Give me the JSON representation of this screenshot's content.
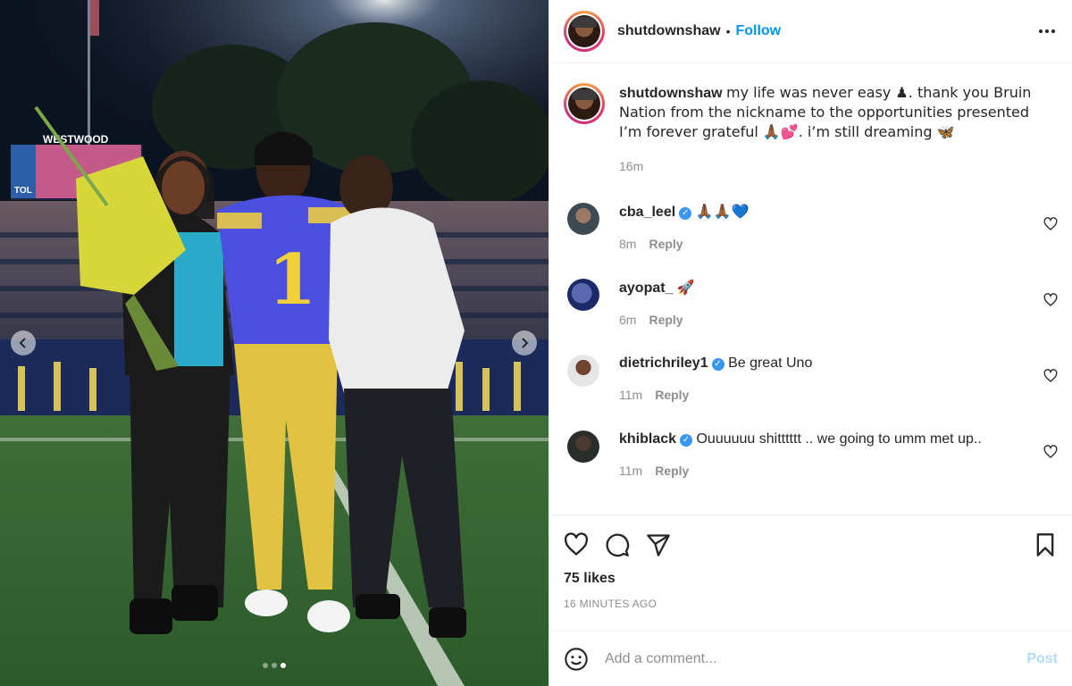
{
  "header": {
    "username": "shutdownshaw",
    "separator": "•",
    "follow_label": "Follow",
    "more_icon": "more-options-icon"
  },
  "media": {
    "prev_icon": "chevron-left-icon",
    "next_icon": "chevron-right-icon",
    "slide_count": 3,
    "active_slide": 3,
    "jersey_number": "1",
    "board_text": "WESTWOOD",
    "scoreboard_text": "TOL"
  },
  "caption": {
    "username": "shutdownshaw",
    "text": "my life was never easy ♟. thank you Bruin Nation from the nickname to the opportunities presented I’m forever grateful 🙏🏾💕. i’m still dreaming 🦋",
    "time": "16m"
  },
  "comments": [
    {
      "username": "cba_leel",
      "verified": true,
      "text": "🙏🏾🙏🏾💙",
      "time": "8m",
      "reply_label": "Reply"
    },
    {
      "username": "ayopat_",
      "verified": false,
      "text": "🚀",
      "time": "6m",
      "reply_label": "Reply"
    },
    {
      "username": "dietrichriley1",
      "verified": true,
      "text": "Be great Uno",
      "time": "11m",
      "reply_label": "Reply"
    },
    {
      "username": "khiblack",
      "verified": true,
      "text": "Ouuuuuu shitttttt .. we going to umm met up..",
      "time": "11m",
      "reply_label": "Reply"
    }
  ],
  "actions": {
    "like_icon": "heart-icon",
    "comment_icon": "comment-icon",
    "share_icon": "share-icon",
    "save_icon": "bookmark-icon",
    "likes": "75 likes",
    "time_ago": "16 MINUTES AGO"
  },
  "add_comment": {
    "emoji_icon": "smiley-icon",
    "placeholder": "Add a comment...",
    "post_label": "Post"
  },
  "colors": {
    "link_blue": "#0095f6",
    "post_disabled": "#b3dbff",
    "muted": "#8e8e8e",
    "verified": "#3897f0"
  }
}
